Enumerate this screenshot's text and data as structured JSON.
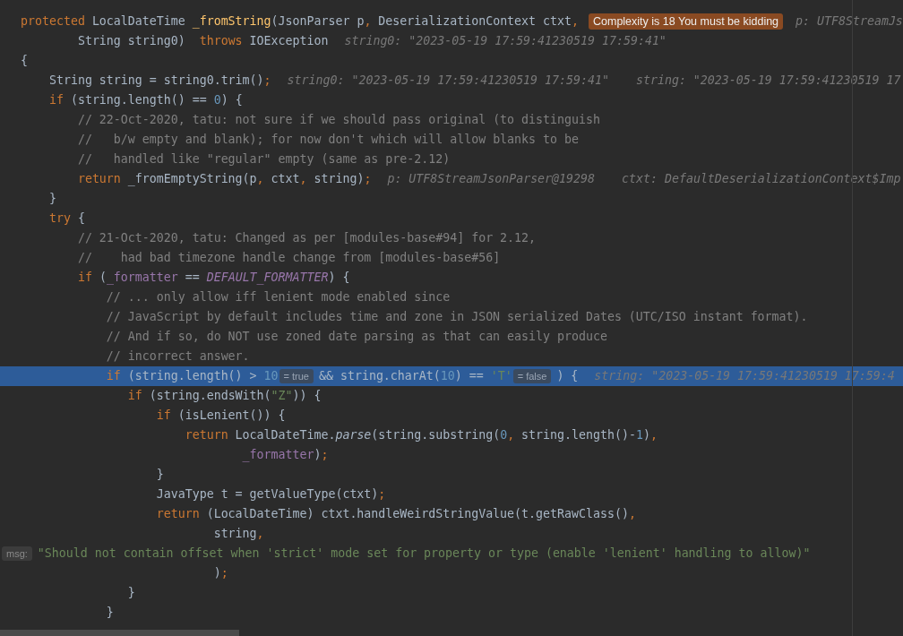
{
  "editor": {
    "lines": [
      {
        "highlighted": false,
        "parts": [
          {
            "kind": "code",
            "tokens": [
              {
                "kind": "keyword",
                "text": "protected "
              },
              {
                "kind": "plain",
                "text": "LocalDateTime "
              },
              {
                "kind": "declaration",
                "text": "_fromString"
              },
              {
                "kind": "plain",
                "text": "(JsonParser p"
              },
              {
                "kind": "keyword",
                "text": ","
              },
              {
                "kind": "plain",
                "text": " DeserializationContext ctxt"
              },
              {
                "kind": "keyword",
                "text": ","
              }
            ]
          },
          {
            "kind": "badge",
            "text": "Complexity is 18 You must be kidding"
          },
          {
            "kind": "hint",
            "text": "p: UTF8StreamJs"
          }
        ]
      },
      {
        "highlighted": false,
        "parts": [
          {
            "kind": "code",
            "tokens": [
              {
                "kind": "plain",
                "text": "        String string0)  "
              },
              {
                "kind": "keyword",
                "text": "throws "
              },
              {
                "kind": "plain",
                "text": "IOException"
              }
            ]
          },
          {
            "kind": "hint",
            "text": "string0: \"2023-05-19 17:59:41230519 17:59:41\""
          }
        ]
      },
      {
        "highlighted": false,
        "parts": [
          {
            "kind": "code",
            "tokens": [
              {
                "kind": "plain",
                "text": "{"
              }
            ]
          }
        ]
      },
      {
        "highlighted": false,
        "parts": [
          {
            "kind": "code",
            "tokens": [
              {
                "kind": "plain",
                "text": "    String string = string0.trim()"
              },
              {
                "kind": "keyword",
                "text": ";"
              }
            ]
          },
          {
            "kind": "hint",
            "text": "string0: \"2023-05-19 17:59:41230519 17:59:41\""
          },
          {
            "kind": "hint",
            "text": "string: \"2023-05-19 17:59:41230519 17"
          }
        ]
      },
      {
        "highlighted": false,
        "parts": [
          {
            "kind": "code",
            "tokens": [
              {
                "kind": "keyword",
                "text": "    if "
              },
              {
                "kind": "plain",
                "text": "(string.length() == "
              },
              {
                "kind": "number",
                "text": "0"
              },
              {
                "kind": "plain",
                "text": ") {"
              }
            ]
          }
        ]
      },
      {
        "highlighted": false,
        "parts": [
          {
            "kind": "code",
            "tokens": [
              {
                "kind": "comment",
                "text": "        // 22-Oct-2020, tatu: not sure if we should pass original (to distinguish"
              }
            ]
          }
        ]
      },
      {
        "highlighted": false,
        "parts": [
          {
            "kind": "code",
            "tokens": [
              {
                "kind": "comment",
                "text": "        //   b/w empty and blank); for now don't which will allow blanks to be"
              }
            ]
          }
        ]
      },
      {
        "highlighted": false,
        "parts": [
          {
            "kind": "code",
            "tokens": [
              {
                "kind": "comment",
                "text": "        //   handled like \"regular\" empty (same as pre-2.12)"
              }
            ]
          }
        ]
      },
      {
        "highlighted": false,
        "parts": [
          {
            "kind": "code",
            "tokens": [
              {
                "kind": "keyword",
                "text": "        return "
              },
              {
                "kind": "plain",
                "text": "_fromEmptyString(p"
              },
              {
                "kind": "keyword",
                "text": ", "
              },
              {
                "kind": "plain",
                "text": "ctxt"
              },
              {
                "kind": "keyword",
                "text": ", "
              },
              {
                "kind": "plain",
                "text": "string)"
              },
              {
                "kind": "keyword",
                "text": ";"
              }
            ]
          },
          {
            "kind": "hint",
            "text": "p: UTF8StreamJsonParser@19298"
          },
          {
            "kind": "hint",
            "text": "ctxt: DefaultDeserializationContext$Imp"
          }
        ]
      },
      {
        "highlighted": false,
        "parts": [
          {
            "kind": "code",
            "tokens": [
              {
                "kind": "plain",
                "text": "    }"
              }
            ]
          }
        ]
      },
      {
        "highlighted": false,
        "parts": [
          {
            "kind": "code",
            "tokens": [
              {
                "kind": "keyword",
                "text": "    try "
              },
              {
                "kind": "plain",
                "text": "{"
              }
            ]
          }
        ]
      },
      {
        "highlighted": false,
        "parts": [
          {
            "kind": "code",
            "tokens": [
              {
                "kind": "comment",
                "text": "        // 21-Oct-2020, tatu: Changed as per [modules-base#94] for 2.12,"
              }
            ]
          }
        ]
      },
      {
        "highlighted": false,
        "parts": [
          {
            "kind": "code",
            "tokens": [
              {
                "kind": "comment",
                "text": "        //    had bad timezone handle change from [modules-base#56]"
              }
            ]
          }
        ]
      },
      {
        "highlighted": false,
        "parts": [
          {
            "kind": "code",
            "tokens": [
              {
                "kind": "keyword",
                "text": "        if "
              },
              {
                "kind": "plain",
                "text": "("
              },
              {
                "kind": "field",
                "text": "_formatter"
              },
              {
                "kind": "plain",
                "text": " == "
              },
              {
                "kind": "constant",
                "text": "DEFAULT_FORMATTER"
              },
              {
                "kind": "plain",
                "text": ") {"
              }
            ]
          }
        ]
      },
      {
        "highlighted": false,
        "parts": [
          {
            "kind": "code",
            "tokens": [
              {
                "kind": "comment",
                "text": "            // ... only allow iff lenient mode enabled since"
              }
            ]
          }
        ]
      },
      {
        "highlighted": false,
        "parts": [
          {
            "kind": "code",
            "tokens": [
              {
                "kind": "comment",
                "text": "            // JavaScript by default includes time and zone in JSON serialized Dates (UTC/ISO instant format)."
              }
            ]
          }
        ]
      },
      {
        "highlighted": false,
        "parts": [
          {
            "kind": "code",
            "tokens": [
              {
                "kind": "comment",
                "text": "            // And if so, do NOT use zoned date parsing as that can easily produce"
              }
            ]
          }
        ]
      },
      {
        "highlighted": false,
        "parts": [
          {
            "kind": "code",
            "tokens": [
              {
                "kind": "comment",
                "text": "            // incorrect answer."
              }
            ]
          }
        ]
      },
      {
        "highlighted": true,
        "parts": [
          {
            "kind": "code",
            "tokens": [
              {
                "kind": "keyword",
                "text": "            if "
              },
              {
                "kind": "plain",
                "text": "(string.length() > "
              },
              {
                "kind": "number",
                "text": "10"
              }
            ]
          },
          {
            "kind": "inlay",
            "text": "= true"
          },
          {
            "kind": "code",
            "tokens": [
              {
                "kind": "plain",
                "text": "&& string.charAt("
              },
              {
                "kind": "number",
                "text": "10"
              },
              {
                "kind": "plain",
                "text": ") == "
              },
              {
                "kind": "string",
                "text": "'T'"
              }
            ]
          },
          {
            "kind": "inlay",
            "text": "= false"
          },
          {
            "kind": "code",
            "tokens": [
              {
                "kind": "plain",
                "text": ") {"
              }
            ]
          },
          {
            "kind": "hint",
            "text": "string: \"2023-05-19 17:59:41230519 17:59:4"
          }
        ]
      },
      {
        "highlighted": false,
        "parts": [
          {
            "kind": "code",
            "tokens": [
              {
                "kind": "keyword",
                "text": "               if "
              },
              {
                "kind": "plain",
                "text": "(string.endsWith("
              },
              {
                "kind": "string",
                "text": "\"Z\""
              },
              {
                "kind": "plain",
                "text": ")) {"
              }
            ]
          }
        ]
      },
      {
        "highlighted": false,
        "parts": [
          {
            "kind": "code",
            "tokens": [
              {
                "kind": "keyword",
                "text": "                   if "
              },
              {
                "kind": "plain",
                "text": "(isLenient()) {"
              }
            ]
          }
        ]
      },
      {
        "highlighted": false,
        "parts": [
          {
            "kind": "code",
            "tokens": [
              {
                "kind": "keyword",
                "text": "                       return "
              },
              {
                "kind": "plain",
                "text": "LocalDateTime."
              },
              {
                "kind": "call",
                "text": "parse"
              },
              {
                "kind": "plain",
                "text": "(string.substring("
              },
              {
                "kind": "number",
                "text": "0"
              },
              {
                "kind": "keyword",
                "text": ", "
              },
              {
                "kind": "plain",
                "text": "string.length()-"
              },
              {
                "kind": "number",
                "text": "1"
              },
              {
                "kind": "plain",
                "text": ")"
              },
              {
                "kind": "keyword",
                "text": ","
              }
            ]
          }
        ]
      },
      {
        "highlighted": false,
        "parts": [
          {
            "kind": "code",
            "tokens": [
              {
                "kind": "field",
                "text": "                               _formatter"
              },
              {
                "kind": "plain",
                "text": ")"
              },
              {
                "kind": "keyword",
                "text": ";"
              }
            ]
          }
        ]
      },
      {
        "highlighted": false,
        "parts": [
          {
            "kind": "code",
            "tokens": [
              {
                "kind": "plain",
                "text": "                   }"
              }
            ]
          }
        ]
      },
      {
        "highlighted": false,
        "parts": [
          {
            "kind": "code",
            "tokens": [
              {
                "kind": "plain",
                "text": "                   JavaType t = getValueType(ctxt)"
              },
              {
                "kind": "keyword",
                "text": ";"
              }
            ]
          }
        ]
      },
      {
        "highlighted": false,
        "parts": [
          {
            "kind": "code",
            "tokens": [
              {
                "kind": "keyword",
                "text": "                   return "
              },
              {
                "kind": "plain",
                "text": "(LocalDateTime) ctxt.handleWeirdStringValue(t.getRawClass()"
              },
              {
                "kind": "keyword",
                "text": ","
              }
            ]
          }
        ]
      },
      {
        "highlighted": false,
        "parts": [
          {
            "kind": "code",
            "tokens": [
              {
                "kind": "plain",
                "text": "                           string"
              },
              {
                "kind": "keyword",
                "text": ","
              }
            ]
          }
        ]
      },
      {
        "highlighted": false,
        "parts": [
          {
            "kind": "inlay",
            "text": "msg:"
          },
          {
            "kind": "code",
            "tokens": [
              {
                "kind": "string",
                "text": "\"Should not contain offset when 'strict' mode set for property or type (enable 'lenient' handling to allow)\""
              }
            ]
          }
        ]
      },
      {
        "highlighted": false,
        "parts": [
          {
            "kind": "code",
            "tokens": [
              {
                "kind": "plain",
                "text": "                           )"
              },
              {
                "kind": "keyword",
                "text": ";"
              }
            ]
          }
        ]
      },
      {
        "highlighted": false,
        "parts": [
          {
            "kind": "code",
            "tokens": [
              {
                "kind": "plain",
                "text": "               }"
              }
            ]
          }
        ]
      },
      {
        "highlighted": false,
        "parts": [
          {
            "kind": "code",
            "tokens": [
              {
                "kind": "plain",
                "text": "            }"
              }
            ]
          }
        ]
      }
    ]
  }
}
